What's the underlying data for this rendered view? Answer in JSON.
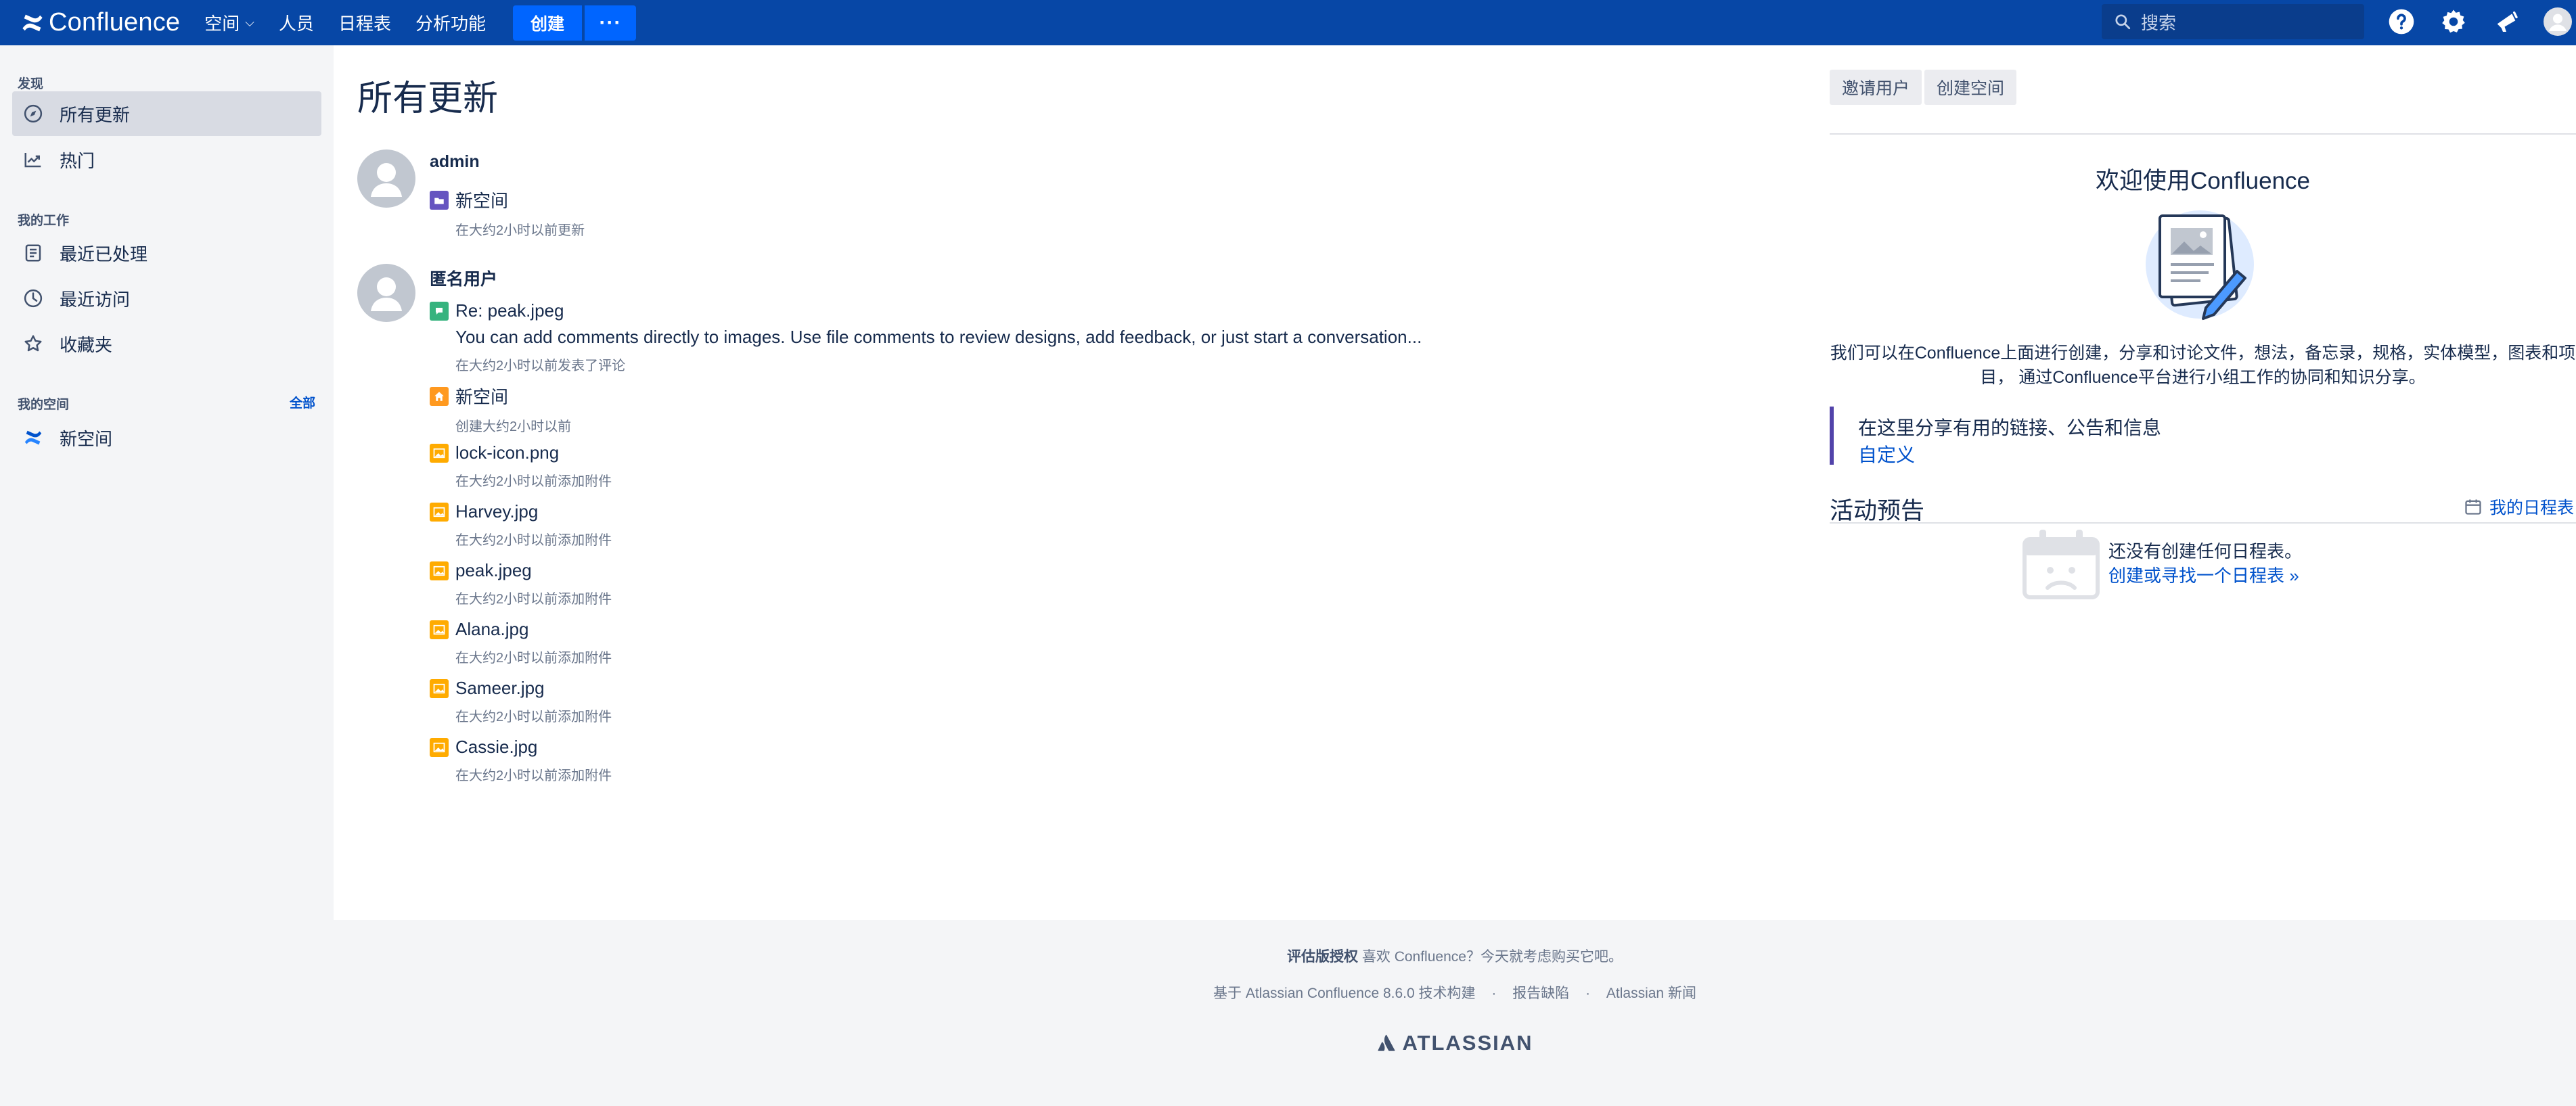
{
  "app": {
    "name": "Confluence"
  },
  "topnav": {
    "items": [
      {
        "label": "空间",
        "has_dropdown": true
      },
      {
        "label": "人员"
      },
      {
        "label": "日程表"
      },
      {
        "label": "分析功能"
      }
    ],
    "create_label": "创建",
    "more_label": "···",
    "search_placeholder": "搜索",
    "icons": [
      "help-icon",
      "settings-icon",
      "notifications-icon",
      "user-avatar-icon"
    ]
  },
  "sidebar": {
    "discover_label": "发现",
    "discover_items": [
      {
        "label": "所有更新",
        "icon": "compass-icon",
        "active": true
      },
      {
        "label": "热门",
        "icon": "trending-icon"
      }
    ],
    "work_label": "我的工作",
    "work_items": [
      {
        "label": "最近已处理",
        "icon": "document-icon"
      },
      {
        "label": "最近访问",
        "icon": "clock-icon"
      },
      {
        "label": "收藏夹",
        "icon": "star-icon"
      }
    ],
    "spaces_label": "我的空间",
    "spaces_all": "全部",
    "space_items": [
      {
        "label": "新空间",
        "icon": "confluence-space-icon"
      }
    ]
  },
  "main": {
    "title": "所有更新",
    "groups": [
      {
        "user": "admin",
        "updates": [
          {
            "title": "新空间",
            "meta": "在大约2小时以前更新",
            "icon": "space-icon",
            "color": "#6554c0"
          }
        ]
      },
      {
        "user": "匿名用户",
        "updates": [
          {
            "title": "Re: peak.jpeg",
            "desc": "You can add comments directly to images. Use file comments to review designs, add feedback, or just start a conversation...",
            "meta": "在大约2小时以前发表了评论",
            "icon": "comment-icon",
            "color": "#36b37e"
          },
          {
            "title": "新空间",
            "meta": "创建大约2小时以前",
            "icon": "home-icon",
            "color": "#ff991f"
          },
          {
            "title": "lock-icon.png",
            "meta": "在大约2小时以前添加附件",
            "icon": "image-icon",
            "color": "#ffab00"
          },
          {
            "title": "Harvey.jpg",
            "meta": "在大约2小时以前添加附件",
            "icon": "image-icon",
            "color": "#ffab00"
          },
          {
            "title": "peak.jpeg",
            "meta": "在大约2小时以前添加附件",
            "icon": "image-icon",
            "color": "#ffab00"
          },
          {
            "title": "Alana.jpg",
            "meta": "在大约2小时以前添加附件",
            "icon": "image-icon",
            "color": "#ffab00"
          },
          {
            "title": "Sameer.jpg",
            "meta": "在大约2小时以前添加附件",
            "icon": "image-icon",
            "color": "#ffab00"
          },
          {
            "title": "Cassie.jpg",
            "meta": "在大约2小时以前添加附件",
            "icon": "image-icon",
            "color": "#ffab00"
          }
        ]
      }
    ]
  },
  "right": {
    "invite_label": "邀请用户",
    "create_space_label": "创建空间",
    "welcome_title": "欢迎使用Confluence",
    "welcome_line1": "我们可以在Confluence上面进行创建，分享和讨论文件，想法，备忘录，规格，实体模型，图表和项",
    "welcome_line2": "目， 通过Confluence平台进行小组工作的协同和知识分享。",
    "share_text": "在这里分享有用的链接、公告和信息",
    "customize_label": "自定义",
    "activity_title": "活动预告",
    "my_calendar_label": "我的日程表",
    "no_calendar_text": "还没有创建任何日程表。",
    "create_calendar_link": "创建或寻找一个日程表 »"
  },
  "footer": {
    "eval_bold": "评估版授权",
    "eval_text": " 喜欢 Confluence？今天就考虑购买它吧。",
    "powered": "基于 Atlassian Confluence 8.6.0 技术构建",
    "report": "报告缺陷",
    "news": "Atlassian 新闻",
    "dot": "·",
    "brand": "ATLASSIAN"
  }
}
